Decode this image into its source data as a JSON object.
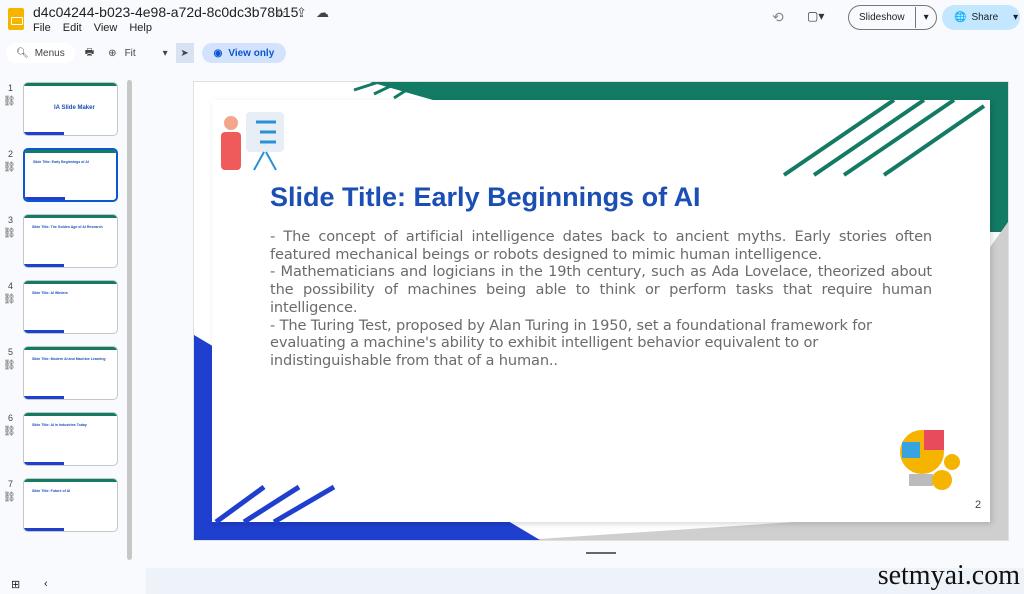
{
  "doc": {
    "title": "d4c04244-b023-4e98-a72d-8c0dc3b78b15",
    "menus": [
      "File",
      "Edit",
      "View",
      "Help"
    ]
  },
  "toolbar": {
    "search": "Menus",
    "zoom": "Fit",
    "view_only": "View only"
  },
  "header": {
    "slideshow": "Slideshow",
    "share": "Share"
  },
  "thumbnails": [
    {
      "num": "1",
      "title": "IA Slide Maker"
    },
    {
      "num": "2",
      "title": "Slide Title: Early Beginnings of AI"
    },
    {
      "num": "3",
      "title": "Slide Title: The Golden Age of AI Research"
    },
    {
      "num": "4",
      "title": "Slide Title: AI Winters"
    },
    {
      "num": "5",
      "title": "Slide Title: Modern AI and Machine Learning"
    },
    {
      "num": "6",
      "title": "Slide Title: AI in Industries Today"
    },
    {
      "num": "7",
      "title": "Slide Title: Future of AI"
    }
  ],
  "slide": {
    "title": "Slide Title: Early Beginnings of AI",
    "body": [
      "- The concept of artificial intelligence dates back to ancient myths. Early stories often featured mechanical beings or robots designed to mimic human intelligence.",
      "- Mathematicians and logicians in the 19th century, such as Ada Lovelace, theorized about the possibility of machines being able to think or perform tasks that require human intelligence.",
      "- The Turing Test, proposed by Alan Turing in 1950, set a foundational framework for evaluating a machine's ability to exhibit intelligent behavior equivalent to or indistinguishable from that of a human.."
    ],
    "page": "2",
    "colors": {
      "title": "#1b4fb3",
      "teal": "#137a63",
      "blue": "#1f3fcf"
    }
  },
  "watermark": "setmyai.com"
}
